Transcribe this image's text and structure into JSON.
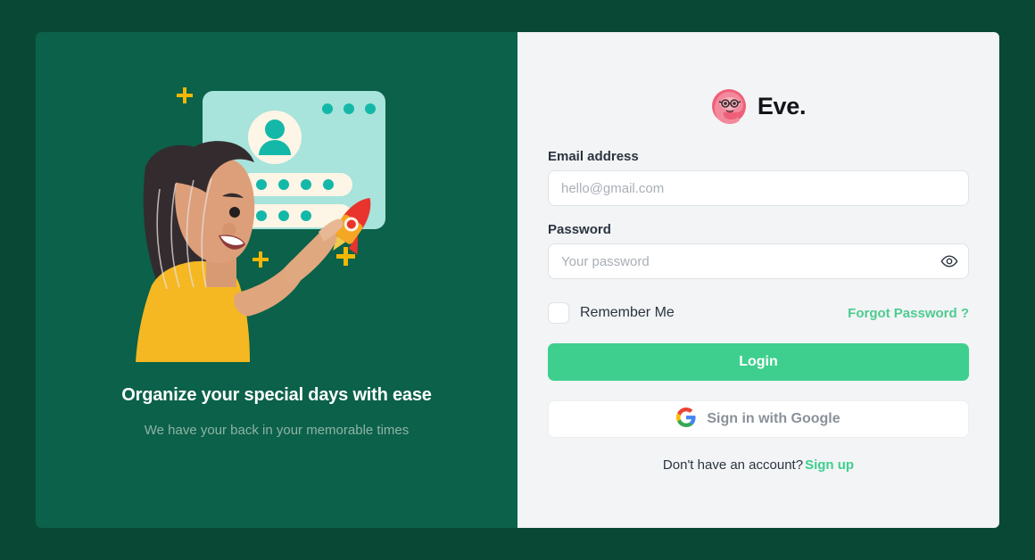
{
  "brand": {
    "name": "Eve.",
    "logo_icon": "eve-mascot-icon"
  },
  "left": {
    "illustration_icon": "woman-login-illustration",
    "tagline": "Organize your special days with ease",
    "subtagline": "We have your back in your memorable times"
  },
  "form": {
    "email": {
      "label": "Email address",
      "placeholder": "hello@gmail.com",
      "value": ""
    },
    "password": {
      "label": "Password",
      "placeholder": "Your password",
      "value": "",
      "toggle_icon": "eye-icon"
    },
    "remember_me": {
      "label": "Remember Me",
      "checked": false
    },
    "forgot_password": "Forgot Password ?",
    "login_button": "Login",
    "google_button": {
      "label": "Sign in with Google",
      "icon": "google-g-icon"
    },
    "signup_prompt": "Don't have an account?",
    "signup_link": "Sign up"
  },
  "colors": {
    "page_background": "#0a4836",
    "left_panel": "#0b6149",
    "right_panel": "#f2f4f5",
    "accent_green": "#3ecf8e",
    "link_green": "#4ecb91",
    "tagline_white": "#ffffff",
    "subtagline_muted": "#8fb3a6",
    "logo_pink": "#ef5f7a",
    "illustration_card": "#a8e3dc",
    "illustration_teal": "#14b8a8",
    "illustration_cream": "#fdf5e6",
    "illustration_yellow": "#f5b823",
    "illustration_skin": "#d89a73",
    "illustration_hair": "#332b2e",
    "rocket_red": "#e8342d",
    "sparkle_gold": "#f2b705"
  }
}
